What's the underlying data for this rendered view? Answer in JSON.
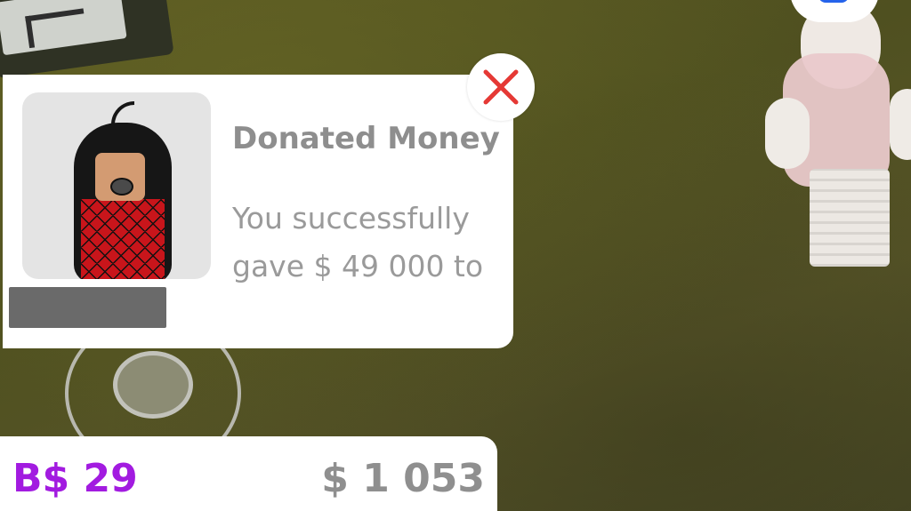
{
  "notification": {
    "title": "Donated Money",
    "message_line1": "You successfully",
    "message_line2": "gave $ 49 000 to",
    "close_icon": "close-x-icon",
    "close_color": "#e53935"
  },
  "currency": {
    "bucks": "B$ 29",
    "bucks_color": "#a21be0",
    "cash": "$ 1 053"
  }
}
